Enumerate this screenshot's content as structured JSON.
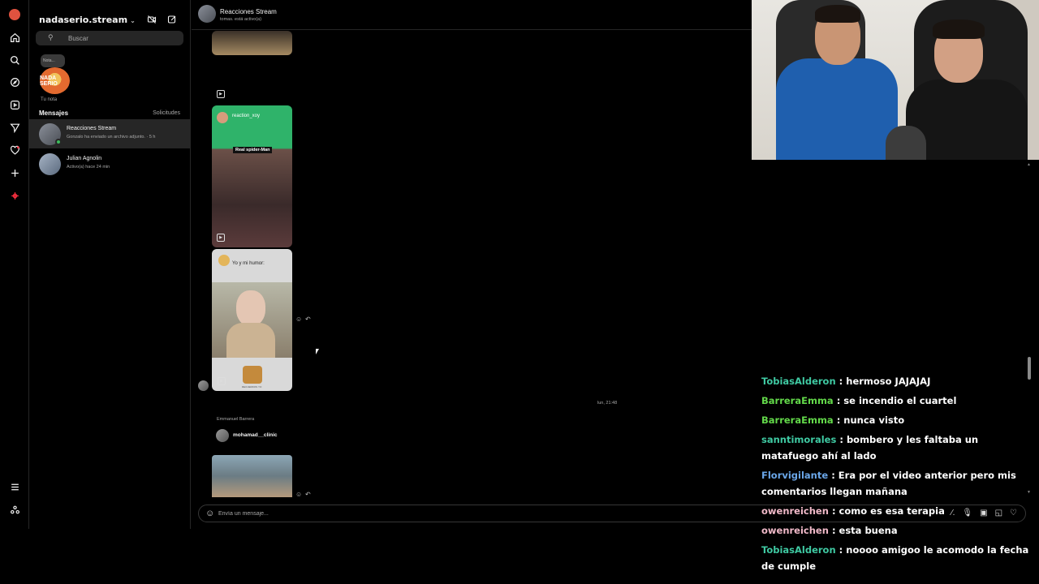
{
  "inbox": {
    "account": "nadaserio.stream",
    "search_placeholder": "Buscar",
    "note_bubble": "Nota...",
    "note_avatar_text": "NADA SERIO",
    "note_label": "Tu nota",
    "section_title": "Mensajes",
    "section_link": "Solicitudes",
    "conversations": [
      {
        "name": "Reacciones Stream",
        "sub": "Gonzalo ha enviado un archivo adjunto. · 5 h"
      },
      {
        "name": "Julian Agnolin",
        "sub": "Activo(a) hace 24 min"
      }
    ]
  },
  "chat": {
    "title": "Reacciones Stream",
    "status": "tomas. está activo(a)",
    "reel1_user": "reaction_xoy",
    "reel1_caption": "Real spider-Man",
    "reel2_caption": "Yo y mi humor:",
    "reel2_footer": "RECUERDOS YO",
    "timestamp": "lun, 21:48",
    "sender": "Emmanuel Barrera",
    "share_user": "mohamad__clinic",
    "composer_placeholder": "Envía un mensaje..."
  },
  "stream_chat": [
    {
      "user": "TobiasAlderon",
      "color": "#3fc9a2",
      "text": ": hermoso JAJAJAJ"
    },
    {
      "user": "BarreraEmma",
      "color": "#63d94a",
      "text": ": se incendio el cuartel"
    },
    {
      "user": "BarreraEmma",
      "color": "#63d94a",
      "text": ": nunca visto"
    },
    {
      "user": "sanntimorales",
      "color": "#3fc9a2",
      "text": ": bombero y les faltaba un matafuego ahí al lado"
    },
    {
      "user": "Florvigilante",
      "color": "#6aa6e8",
      "text": ": Era por el video anterior pero mis comentarios llegan mañana"
    },
    {
      "user": "owenreichen",
      "color": "#f0b9c8",
      "text": ": como es esa terapia"
    },
    {
      "user": "owenreichen",
      "color": "#f0b9c8",
      "text": ": esta buena"
    },
    {
      "user": "TobiasAlderon",
      "color": "#3fc9a2",
      "text": ": noooo amigoo le acomodo la fecha de cumple"
    }
  ],
  "colors": {
    "background": "#000000",
    "active_row": "#262626",
    "online_dot": "#3bbb5c",
    "notification_icon": "#ff3040"
  },
  "icons": {
    "rail": [
      "instagram-logo",
      "home-icon",
      "search-icon",
      "explore-icon",
      "reels-icon",
      "messages-icon",
      "heart-icon",
      "create-icon",
      "meta-icon",
      "menu-icon",
      "threads-icon"
    ],
    "composer": [
      "gif-icon",
      "mic-icon",
      "image-icon",
      "sticker-icon",
      "heart-icon"
    ]
  }
}
